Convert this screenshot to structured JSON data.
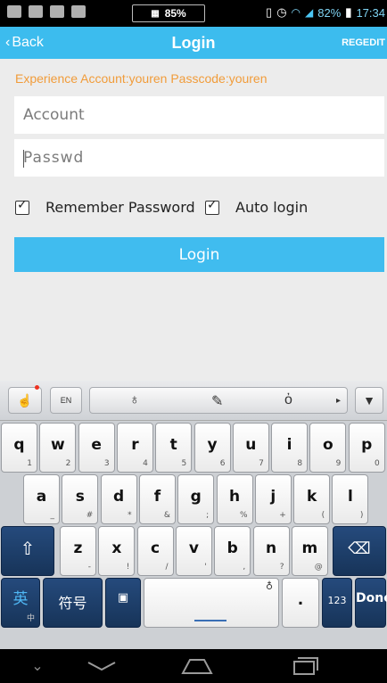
{
  "status_bar": {
    "battery_center": "85%",
    "battery_right": "82%",
    "time": "17:34"
  },
  "title_bar": {
    "back_label": "Back",
    "title": "Login",
    "register_label": "REGEDIT"
  },
  "hint": "Experience Account:youren Passcode:youren",
  "form": {
    "account_placeholder": "Account",
    "password_placeholder": "Passwd",
    "remember_label": "Remember Password",
    "remember_checked": true,
    "auto_login_label": "Auto login",
    "auto_login_checked": true,
    "login_label": "Login"
  },
  "colors": {
    "accent": "#3cbcee",
    "hint": "#f19c3a"
  },
  "keyboard": {
    "toolbar": {
      "lang_label": "EN",
      "icons": [
        "handwriting-icon",
        "language-icon",
        "microphone-icon",
        "pen-icon",
        "weibo-icon",
        "hide-keyboard-icon"
      ]
    },
    "row1": [
      {
        "k": "q",
        "s": "1"
      },
      {
        "k": "w",
        "s": "2"
      },
      {
        "k": "e",
        "s": "3"
      },
      {
        "k": "r",
        "s": "4"
      },
      {
        "k": "t",
        "s": "5"
      },
      {
        "k": "y",
        "s": "6"
      },
      {
        "k": "u",
        "s": "7"
      },
      {
        "k": "i",
        "s": "8"
      },
      {
        "k": "o",
        "s": "9"
      },
      {
        "k": "p",
        "s": "0"
      }
    ],
    "row2": [
      {
        "k": "a",
        "s": "_"
      },
      {
        "k": "s",
        "s": "#"
      },
      {
        "k": "d",
        "s": "*"
      },
      {
        "k": "f",
        "s": "&"
      },
      {
        "k": "g",
        "s": ";"
      },
      {
        "k": "h",
        "s": "%"
      },
      {
        "k": "j",
        "s": "+"
      },
      {
        "k": "k",
        "s": "("
      },
      {
        "k": "l",
        "s": ")"
      }
    ],
    "row3": [
      {
        "k": "z",
        "s": "-"
      },
      {
        "k": "x",
        "s": "!"
      },
      {
        "k": "c",
        "s": "/"
      },
      {
        "k": "v",
        "s": "'"
      },
      {
        "k": "b",
        "s": ","
      },
      {
        "k": "n",
        "s": "?"
      },
      {
        "k": "m",
        "s": "@"
      }
    ],
    "row4": {
      "lang_key": "英",
      "lang_sub": "中",
      "symbols_key": "符号",
      "period_key": ".",
      "numbers_key": "123",
      "done_key": "Done"
    }
  }
}
